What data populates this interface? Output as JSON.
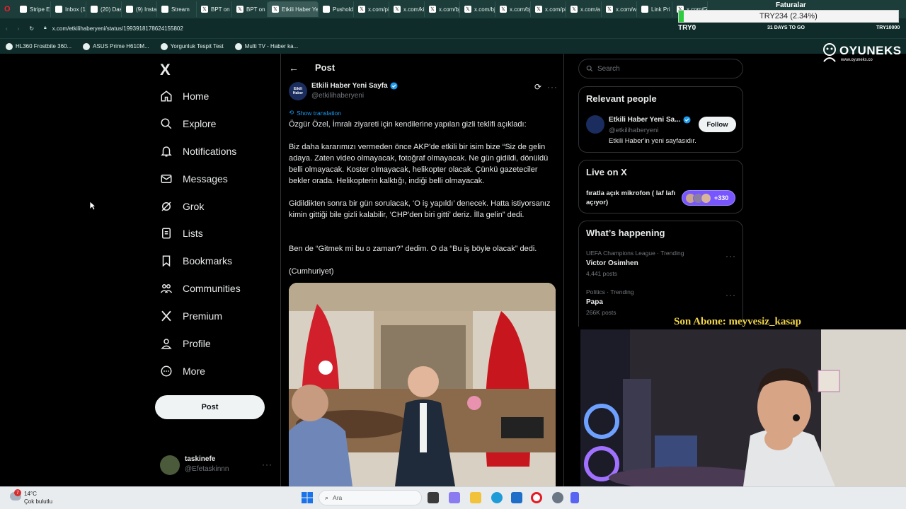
{
  "browser": {
    "tabs": [
      {
        "label": "Stripe Ex",
        "icon": "stripe-icon"
      },
      {
        "label": "Inbox (1",
        "icon": "mail-icon"
      },
      {
        "label": "(20) Das",
        "icon": "dashboard-icon"
      },
      {
        "label": "(9) Insta",
        "icon": "instagram-icon"
      },
      {
        "label": "Stream",
        "icon": "kick-icon"
      },
      {
        "label": "BPT on X",
        "icon": "x-icon"
      },
      {
        "label": "BPT on X",
        "icon": "x-icon"
      },
      {
        "label": "Etkili Haber Yen",
        "icon": "x-icon",
        "active": true
      },
      {
        "label": "Pusholdc",
        "icon": "doc-icon"
      },
      {
        "label": "x.com/pi",
        "icon": "x-icon"
      },
      {
        "label": "x.com/ki",
        "icon": "x-icon"
      },
      {
        "label": "x.com/bj",
        "icon": "x-icon"
      },
      {
        "label": "x.com/bj",
        "icon": "x-icon"
      },
      {
        "label": "x.com/bj",
        "icon": "x-icon"
      },
      {
        "label": "x.com/pi",
        "icon": "x-icon"
      },
      {
        "label": "x.com/a",
        "icon": "x-icon"
      },
      {
        "label": "x.com/w",
        "icon": "x-icon"
      },
      {
        "label": "Link Pri",
        "icon": "link-icon"
      },
      {
        "label": "x.com/G",
        "icon": "x-icon"
      }
    ],
    "url": "x.com/etkilihaberyeni/status/1993918178624155802",
    "bookmarks": [
      "HL360 Frostbite 360...",
      "ASUS Prime H610M...",
      "Yorgunluk Tespit Test",
      "Multi TV - Haber ka..."
    ]
  },
  "overlay": {
    "title": "Faturalar",
    "amount": "TRY234 (2.34%)",
    "left_value": "TRY0",
    "days": "31 DAYS TO GO",
    "right_value": "TRY10000",
    "brand": "OYUNEKS",
    "brand_url": "www.oyuneks.co",
    "subscriber": "Son Abone: meyvesiz_kasap"
  },
  "nav": {
    "logo": "X",
    "items": [
      "Home",
      "Explore",
      "Notifications",
      "Messages",
      "Grok",
      "Lists",
      "Bookmarks",
      "Communities",
      "Premium",
      "Profile",
      "More"
    ],
    "post_button": "Post",
    "account": {
      "name": "taskinefe",
      "handle": "@Efetaskinnn"
    }
  },
  "post": {
    "header": "Post",
    "author": "Etkili Haber Yeni Sayfa",
    "handle": "@etkilihaberyeni",
    "avatar_text": "Etkili Haber",
    "show_translation": "Show translation",
    "paragraphs": [
      "Özgür Özel, İmralı ziyareti için kendilerine yapılan gizli teklifi açıkladı:",
      "Biz daha kararımızı vermeden önce AKP'de etkili bir isim bize “Siz de gelin adaya. Zaten video olmayacak, fotoğraf olmayacak. Ne gün gidildi, dönüldü belli olmayacak. Koster olmayacak, helikopter olacak. Çünkü gazeteciler bekler orada. Helikopterin kalktığı, indiği belli olmayacak.",
      "Gidildikten sonra bir gün sorulacak, ‘O iş yapıldı’ denecek. Hatta istiyorsanız kimin gittiği bile gizli kalabilir, ‘CHP'den biri gitti’ deriz. İlla gelin” dedi.",
      "Ben de “Gitmek mi bu o zaman?” dedim. O da “Bu iş böyle olacak” dedi.",
      "(Cumhuriyet)"
    ]
  },
  "sidebar": {
    "search_placeholder": "Search",
    "relevant_title": "Relevant people",
    "relevant": {
      "name": "Etkili Haber Yeni Sa...",
      "handle": "@etkilihaberyeni",
      "bio": "Etkili Haber'in yeni sayfasıdır.",
      "follow": "Follow"
    },
    "live_title": "Live on X",
    "live": {
      "text": "fıratla açık mikrofon ( laf lafı açıyor)",
      "count": "+330"
    },
    "happening_title": "What’s happening",
    "trends": [
      {
        "context": "UEFA Champions League · Trending",
        "name": "Victor Osimhen",
        "posts": "4,441 posts"
      },
      {
        "context": "Politics · Trending",
        "name": "Papa",
        "posts": "266K posts"
      }
    ]
  },
  "taskbar": {
    "weather_temp": "14°C",
    "weather_text": "Çok bulutlu",
    "weather_badge": "7",
    "search_label": "Ara"
  }
}
